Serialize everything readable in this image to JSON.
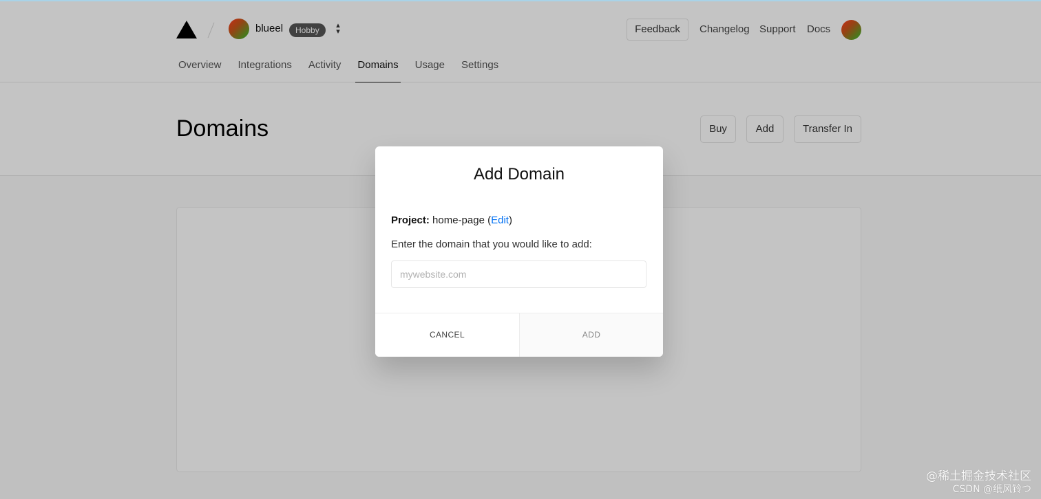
{
  "header": {
    "logo_icon": "triangle-logo-icon",
    "team": {
      "name": "blueel",
      "plan": "Hobby",
      "switcher_icon": "chevron-up-down-icon"
    },
    "feedback_label": "Feedback",
    "links": [
      "Changelog",
      "Support",
      "Docs"
    ],
    "tabs": [
      {
        "label": "Overview"
      },
      {
        "label": "Integrations"
      },
      {
        "label": "Activity"
      },
      {
        "label": "Domains",
        "active": true
      },
      {
        "label": "Usage"
      },
      {
        "label": "Settings"
      }
    ]
  },
  "page": {
    "title": "Domains",
    "buttons": {
      "buy": "Buy",
      "add": "Add",
      "transfer": "Transfer In"
    }
  },
  "modal": {
    "title": "Add Domain",
    "project_label": "Project:",
    "project_name": "home-page",
    "edit_label": "Edit",
    "instruction": "Enter the domain that you would like to add:",
    "input_placeholder": "mywebsite.com",
    "input_value": "",
    "cancel_label": "CANCEL",
    "add_label": "ADD"
  },
  "watermark": {
    "line1": "@稀土掘金技术社区",
    "line2": "CSDN @纸风铃つ"
  },
  "colors": {
    "link_blue": "#0070f3",
    "badge_bg": "#555555",
    "overlay": "rgba(0,0,0,0.23)"
  }
}
